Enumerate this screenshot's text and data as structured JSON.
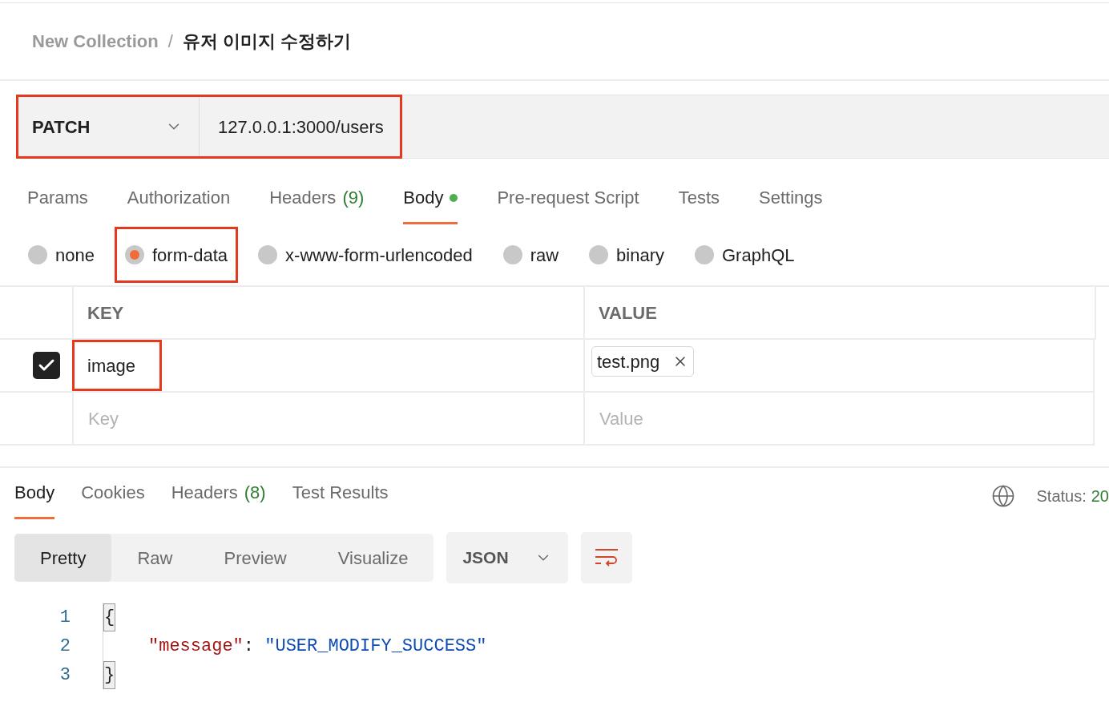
{
  "breadcrumb": {
    "collection": "New Collection",
    "separator": "/",
    "request": "유저 이미지 수정하기"
  },
  "request": {
    "method": "PATCH",
    "url": "127.0.0.1:3000/users",
    "highlighted": true
  },
  "tabs": [
    {
      "label": "Params",
      "selected": false
    },
    {
      "label": "Authorization",
      "selected": false
    },
    {
      "label": "Headers",
      "count": "(9)",
      "selected": false
    },
    {
      "label": "Body",
      "dot": true,
      "selected": true
    },
    {
      "label": "Pre-request Script",
      "selected": false
    },
    {
      "label": "Tests",
      "selected": false
    },
    {
      "label": "Settings",
      "selected": false
    }
  ],
  "body_types": [
    {
      "label": "none",
      "selected": false,
      "highlighted": false
    },
    {
      "label": "form-data",
      "selected": true,
      "highlighted": true
    },
    {
      "label": "x-www-form-urlencoded",
      "selected": false,
      "highlighted": false
    },
    {
      "label": "raw",
      "selected": false,
      "highlighted": false
    },
    {
      "label": "binary",
      "selected": false,
      "highlighted": false
    },
    {
      "label": "GraphQL",
      "selected": false,
      "highlighted": false
    }
  ],
  "table": {
    "columns": [
      "KEY",
      "VALUE"
    ],
    "rows": [
      {
        "kind": "file",
        "checked": true,
        "key": "image",
        "value": "test.png",
        "highlighted": true
      }
    ],
    "new_row": {
      "key_placeholder": "Key",
      "value_placeholder": "Value"
    }
  },
  "response": {
    "tabs": [
      {
        "label": "Body",
        "selected": true
      },
      {
        "label": "Cookies",
        "selected": false
      },
      {
        "label": "Headers",
        "count": "(8)",
        "selected": false
      },
      {
        "label": "Test Results",
        "selected": false
      }
    ],
    "status": {
      "label": "Status:",
      "value": "20"
    },
    "view_modes": [
      {
        "label": "Pretty",
        "selected": true
      },
      {
        "label": "Raw",
        "selected": false
      },
      {
        "label": "Preview",
        "selected": false
      },
      {
        "label": "Visualize",
        "selected": false
      }
    ],
    "format": "JSON",
    "lines": [
      {
        "number": "1",
        "tokens": [
          {
            "kind": "bracket",
            "text": "{"
          }
        ]
      },
      {
        "number": "2",
        "tokens": [
          {
            "kind": "key",
            "text": "\"message\""
          },
          {
            "kind": "punct",
            "text": ": "
          },
          {
            "kind": "string",
            "text": "\"USER_MODIFY_SUCCESS\""
          }
        ]
      },
      {
        "number": "3",
        "tokens": [
          {
            "kind": "bracket",
            "text": "}"
          }
        ]
      }
    ]
  }
}
